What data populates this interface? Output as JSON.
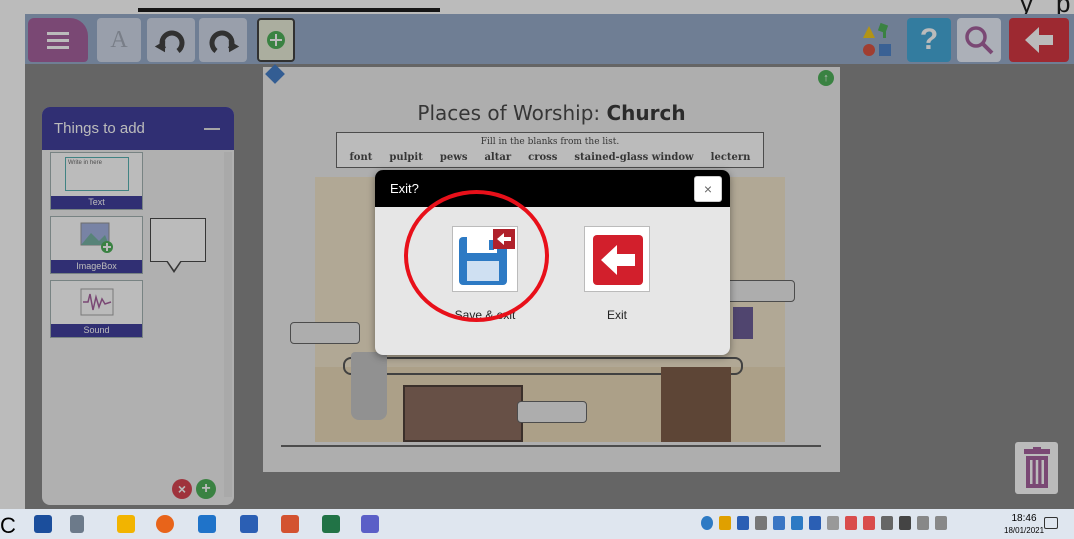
{
  "top_strip": {
    "right_glyph_1": "y",
    "right_glyph_2": "p"
  },
  "toolbar": {
    "font_label": "A",
    "help_label": "?",
    "icons": [
      "menu-icon",
      "font-icon",
      "undo-icon",
      "redo-icon",
      "add-page-icon",
      "shapes-icon",
      "help-icon",
      "zoom-icon",
      "back-arrow-icon"
    ],
    "colors": {
      "toolbar": "#8aa2c4",
      "menu": "#9b4f93",
      "help": "#2e9fd4",
      "back": "#d21f2c"
    }
  },
  "panel": {
    "title": "Things to add",
    "text_tool_inner": "Write in here",
    "tools": [
      {
        "label": "Text"
      },
      {
        "label": "ImageBox"
      },
      {
        "label": "Sound"
      }
    ],
    "color": "#2a2891"
  },
  "worksheet": {
    "title_prefix": "Places of Worship: ",
    "title_bold": "Church",
    "instruction": "Fill in the blanks from the list.",
    "words": [
      "font",
      "pulpit",
      "pews",
      "altar",
      "cross",
      "stained-glass window",
      "lectern"
    ]
  },
  "dialog": {
    "title": "Exit?",
    "close_label": "×",
    "options": [
      {
        "label": "Save & exit"
      },
      {
        "label": "Exit"
      }
    ],
    "highlight_color": "#e8101a"
  },
  "taskbar": {
    "partial_text": "C",
    "time": "18:46",
    "date": "18/01/2021"
  }
}
